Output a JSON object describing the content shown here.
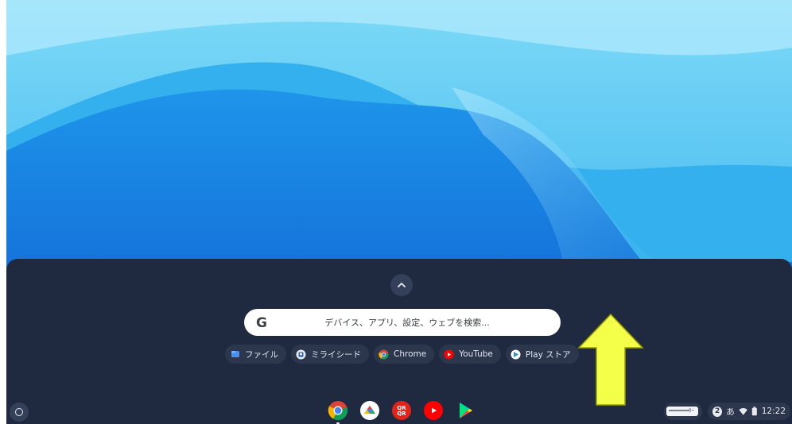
{
  "search": {
    "placeholder": "デバイス、アプリ、設定、ウェブを検索..."
  },
  "suggestions": [
    {
      "label": "ファイル",
      "icon": "files-icon"
    },
    {
      "label": "ミライシード",
      "icon": "miraiseed-icon"
    },
    {
      "label": "Chrome",
      "icon": "chrome-icon"
    },
    {
      "label": "YouTube",
      "icon": "youtube-icon"
    },
    {
      "label": "Play ストア",
      "icon": "play-store-icon"
    }
  ],
  "shelf": {
    "apps": [
      "chrome-icon",
      "google-home-icon",
      "qr-reader-icon",
      "youtube-icon",
      "play-store-icon"
    ]
  },
  "ime": {
    "text": "ﾘｰ"
  },
  "status": {
    "notification_count": "2",
    "input_method": "あ",
    "time": "12:22"
  },
  "colors": {
    "arrow": "#f4ff4a",
    "launcher_bg": "#1f2a40",
    "chip_bg": "#2c374e"
  }
}
